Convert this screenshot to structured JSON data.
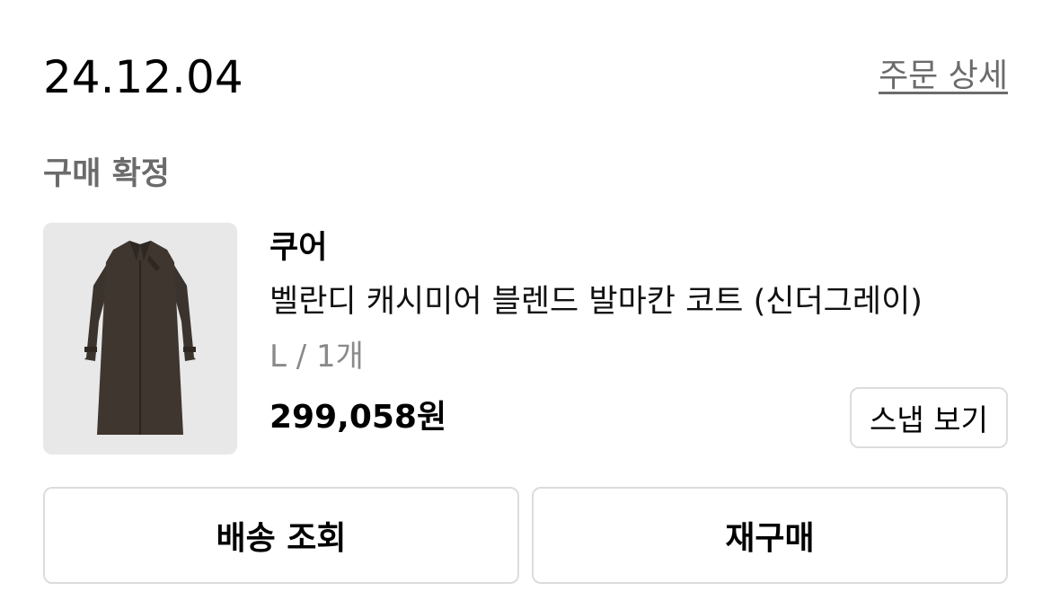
{
  "order": {
    "date": "24.12.04",
    "detail_link": "주문 상세",
    "status": "구매 확정"
  },
  "product": {
    "brand": "쿠어",
    "name": "벨란디 캐시미어 블렌드 발마칸 코트 (신더그레이)",
    "option": "L / 1개",
    "price": "299,058원",
    "image_icon": "coat-image",
    "snap_button": "스냅 보기"
  },
  "actions": {
    "track_delivery": "배송 조회",
    "reorder": "재구매"
  },
  "colors": {
    "secondary_text": "#6b6b6b",
    "muted_text": "#8a8a8a",
    "border": "#dcdcdc",
    "thumb_bg": "#e8e8e8",
    "coat": "#3b332d"
  }
}
